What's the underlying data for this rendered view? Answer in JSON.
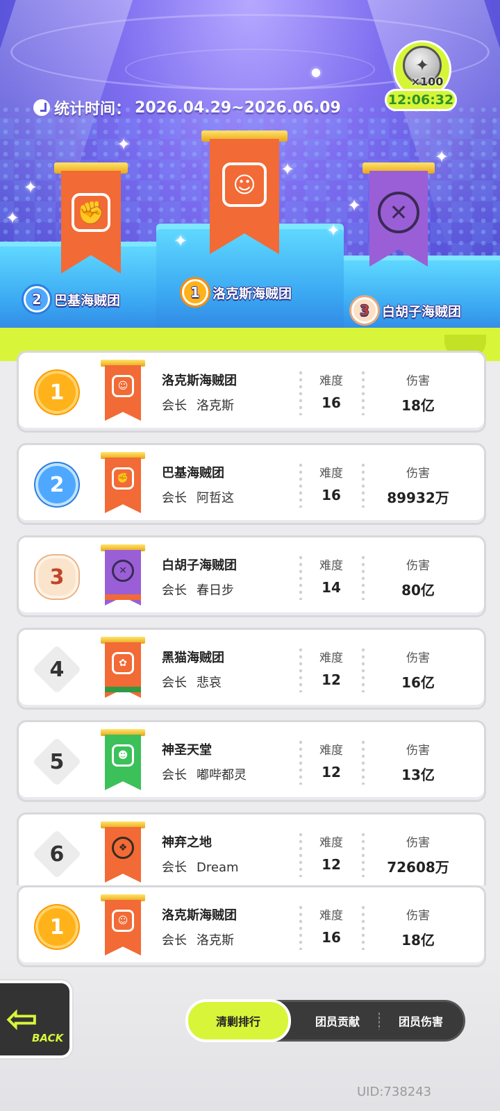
{
  "header": {
    "stat_time_label": "统计时间：",
    "stat_time_range": "2026.04.29~2026.06.09"
  },
  "reward": {
    "icon": "shuriken-coin-icon",
    "count": "×100",
    "timer": "12:06:32"
  },
  "podium": [
    {
      "rank": "1",
      "name": "洛克斯海贼团",
      "emblem": "☺"
    },
    {
      "rank": "2",
      "name": "巴基海贼团",
      "emblem": "✊"
    },
    {
      "rank": "3",
      "name": "白胡子海贼团",
      "emblem": "✕"
    }
  ],
  "columns": {
    "difficulty": "难度",
    "damage": "伤害",
    "leader_label": "会长"
  },
  "rows": [
    {
      "rank": "1",
      "name": "洛克斯海贼团",
      "leader": "洛克斯",
      "difficulty": "16",
      "damage": "18亿",
      "emblem": "☺"
    },
    {
      "rank": "2",
      "name": "巴基海贼团",
      "leader": "阿哲这",
      "difficulty": "16",
      "damage": "89932万",
      "emblem": "✊"
    },
    {
      "rank": "3",
      "name": "白胡子海贼团",
      "leader": "春日步",
      "difficulty": "14",
      "damage": "80亿",
      "emblem": "✕"
    },
    {
      "rank": "4",
      "name": "黑猫海贼团",
      "leader": "悲哀",
      "difficulty": "12",
      "damage": "16亿",
      "emblem": "✿"
    },
    {
      "rank": "5",
      "name": "神圣天堂",
      "leader": "嘟哔都灵",
      "difficulty": "12",
      "damage": "13亿",
      "emblem": "☻"
    },
    {
      "rank": "6",
      "name": "神弃之地",
      "leader": "Dream",
      "difficulty": "12",
      "damage": "72608万",
      "emblem": "❖"
    }
  ],
  "self_row": {
    "rank": "1",
    "name": "洛克斯海贼团",
    "leader": "洛克斯",
    "difficulty": "16",
    "damage": "18亿",
    "emblem": "☺"
  },
  "back": {
    "label": "BACK"
  },
  "tabs": [
    {
      "label": "清剿排行",
      "active": true
    },
    {
      "label": "团员贡献",
      "active": false
    },
    {
      "label": "团员伤害",
      "active": false
    }
  ],
  "uid": "UID:738243"
}
